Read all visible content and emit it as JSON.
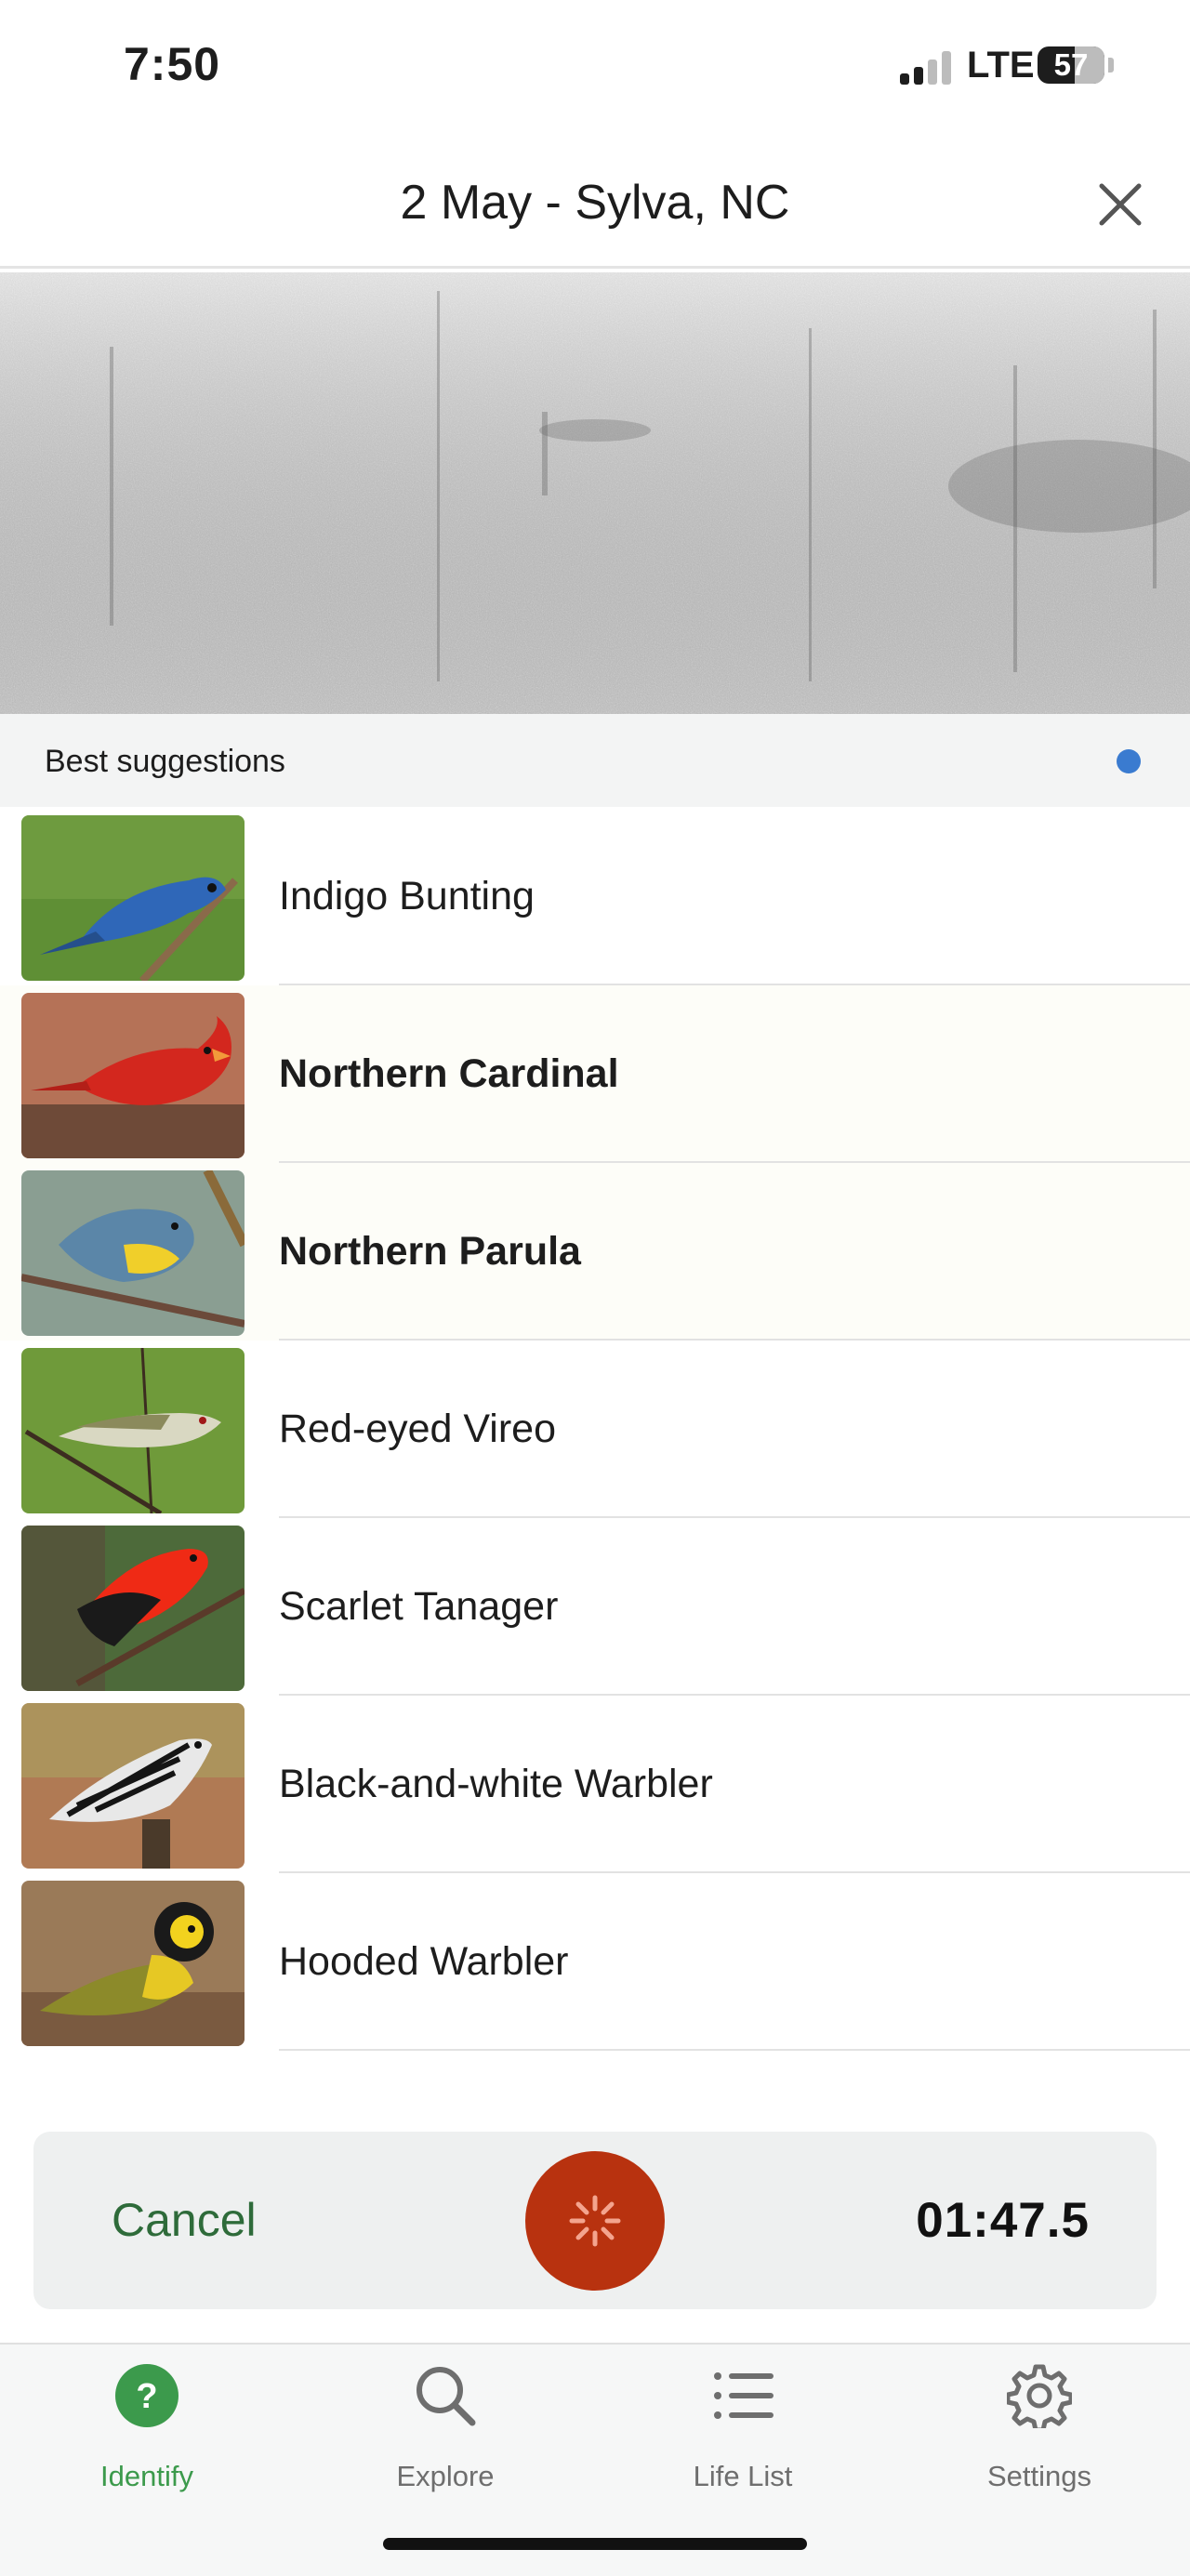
{
  "status_bar": {
    "time": "7:50",
    "network": "LTE",
    "battery": "57"
  },
  "header": {
    "title": "2 May - Sylva, NC",
    "close_icon": "close-icon"
  },
  "suggestions": {
    "heading": "Best suggestions",
    "indicator_color": "#3a7bd0",
    "items": [
      {
        "name": "Indigo Bunting",
        "highlighted": false
      },
      {
        "name": "Northern Cardinal",
        "highlighted": true
      },
      {
        "name": "Northern Parula",
        "highlighted": true
      },
      {
        "name": "Red-eyed Vireo",
        "highlighted": false
      },
      {
        "name": "Scarlet Tanager",
        "highlighted": false
      },
      {
        "name": "Black-and-white Warbler",
        "highlighted": false
      },
      {
        "name": "Hooded Warbler",
        "highlighted": false
      }
    ]
  },
  "controls": {
    "cancel_label": "Cancel",
    "record_icon": "spinner-icon",
    "record_color": "#b8320f",
    "elapsed": "01:47.5"
  },
  "tabs": [
    {
      "label": "Identify",
      "icon": "question-icon",
      "active": true
    },
    {
      "label": "Explore",
      "icon": "search-icon",
      "active": false
    },
    {
      "label": "Life List",
      "icon": "list-icon",
      "active": false
    },
    {
      "label": "Settings",
      "icon": "gear-icon",
      "active": false
    }
  ],
  "colors": {
    "accent_green": "#3c9a4c",
    "cancel_green": "#2e6b3a"
  }
}
